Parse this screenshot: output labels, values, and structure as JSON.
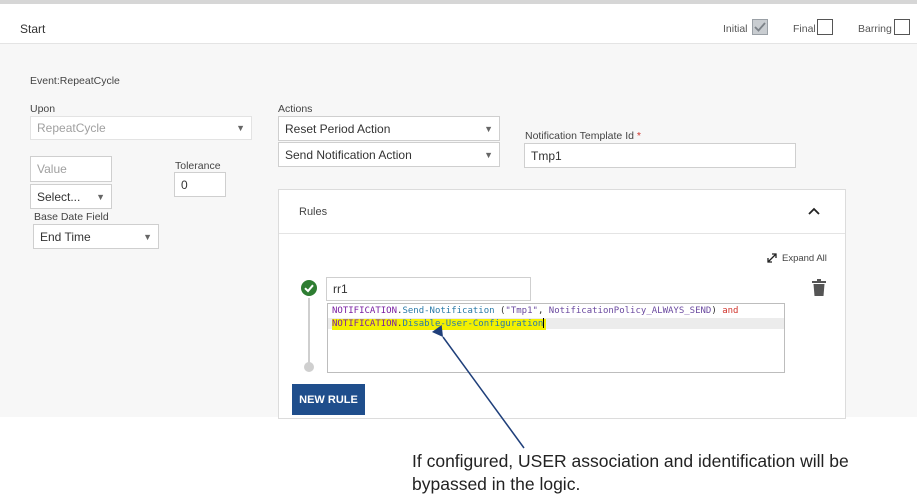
{
  "header": {
    "title": "Start",
    "checkboxes": [
      {
        "label": "Initial",
        "checked": true
      },
      {
        "label": "Final",
        "checked": false
      },
      {
        "label": "Barring",
        "checked": false
      }
    ]
  },
  "event_label": "Event:RepeatCycle",
  "upon": {
    "label": "Upon",
    "value": "RepeatCycle"
  },
  "value_field": {
    "placeholder": "Value"
  },
  "tolerance": {
    "label": "Tolerance",
    "value": "0"
  },
  "unit_select": {
    "value": "Select..."
  },
  "base_date": {
    "label": "Base Date Field",
    "value": "End Time"
  },
  "actions": {
    "label": "Actions",
    "items": [
      "Reset Period Action",
      "Send Notification Action"
    ]
  },
  "notification": {
    "label": "Notification Template Id",
    "required_mark": "*",
    "value": "Tmp1"
  },
  "rules": {
    "title": "Rules",
    "expand_all": "Expand All",
    "rule_name": "rr1",
    "code": {
      "line1": {
        "ns": "NOTIFICATION",
        "dot": ".",
        "method": "Send-Notification",
        "args_open": " (",
        "arg1": "\"Tmp1\"",
        "comma": ", ",
        "arg2": "NotificationPolicy_ALWAYS_SEND",
        "args_close": ") ",
        "op": "and"
      },
      "line2": {
        "ns": "NOTIFICATION",
        "dot": ".",
        "method": "Disable-User-Configuration"
      }
    },
    "new_rule_button": "NEW RULE"
  },
  "annotation": {
    "text": "If configured, USER association and identification will be bypassed in the logic."
  },
  "colors": {
    "primary_button": "#1f4e8c",
    "success": "#2e7d32",
    "highlight": "#f3f000",
    "arrow": "#1f3f7a"
  }
}
